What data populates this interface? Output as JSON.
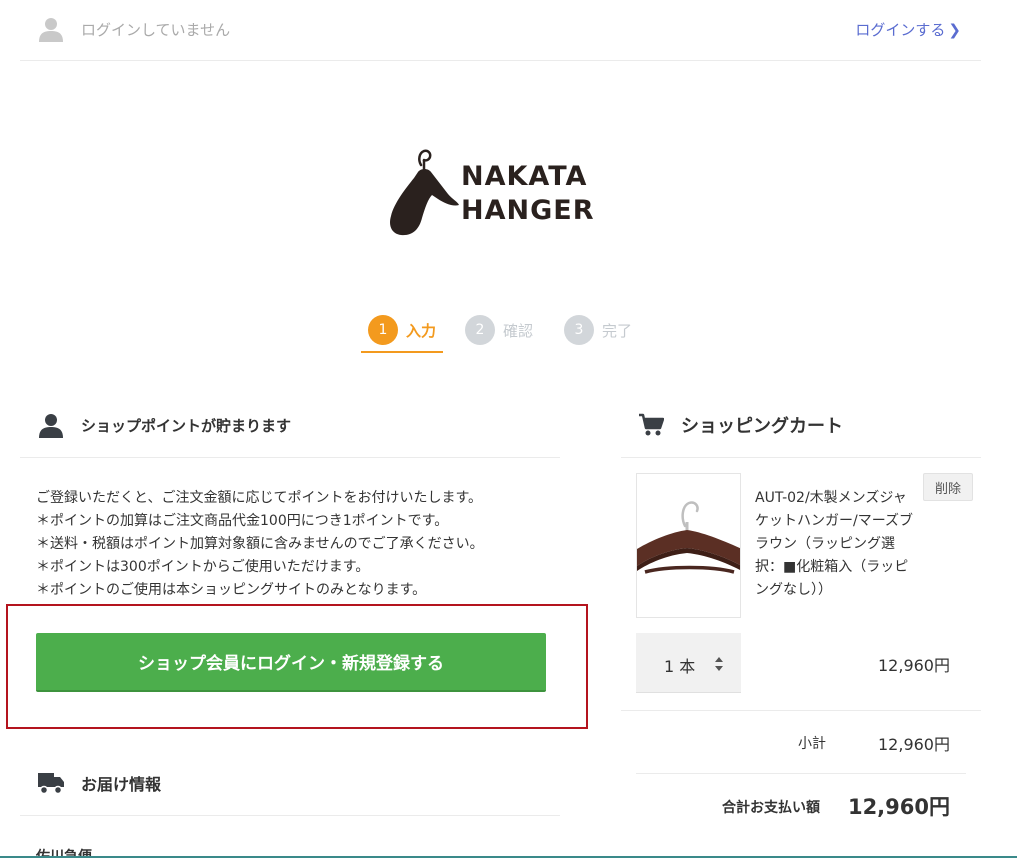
{
  "header": {
    "login_status": "ログインしていません",
    "login_link": "ログインする",
    "login_chevron": "❯"
  },
  "logo": {
    "line1": "NAKATA",
    "line2": "HANGER"
  },
  "steps": [
    {
      "num": "1",
      "label": "入力"
    },
    {
      "num": "2",
      "label": "確認"
    },
    {
      "num": "3",
      "label": "完了"
    }
  ],
  "points_section": {
    "title": "ショップポイントが貯まります",
    "lines": [
      "ご登録いただくと、ご注文金額に応じてポイントをお付けいたします。",
      "＊ポイントの加算はご注文商品代金100円につき1ポイントです。",
      "＊送料・税額はポイント加算対象額に含みませんのでご了承ください。",
      "＊ポイントは300ポイントからご使用いただけます。",
      "＊ポイントのご使用は本ショッピングサイトのみとなります。"
    ],
    "button": "ショップ会員にログイン・新規登録する"
  },
  "shipping_section": {
    "title": "お届け情報",
    "subtitle": "佐川急便"
  },
  "cart": {
    "title": "ショッピングカート",
    "item_name": "AUT-02/木製メンズジャケットハンガー/マーズブラウン（ラッピング選択：■化粧箱入（ラッピングなし））",
    "delete_label": "削除",
    "quantity": "1 本",
    "item_price": "12,960円",
    "subtotal_label": "小計",
    "subtotal_value": "12,960円",
    "total_label": "合計お支払い額",
    "total_value": "12,960円"
  },
  "colors": {
    "accent_orange": "#f39a1e",
    "button_green": "#4cae4c",
    "highlight_red": "#b4141e",
    "link_blue": "#5a6cd0"
  }
}
